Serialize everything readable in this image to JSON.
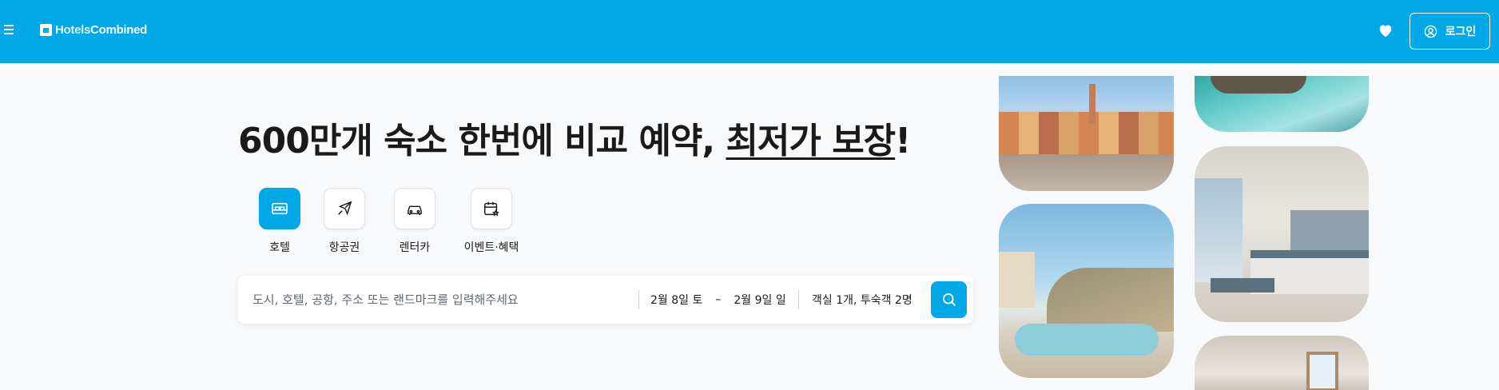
{
  "header": {
    "brand": {
      "part1": "Hotels",
      "part2": "Combined"
    },
    "login_label": "로그인",
    "bg_color": "#00a8e8"
  },
  "hero": {
    "headline_plain": "600만개 숙소 한번에 비교 예약, ",
    "headline_underlined": "최저가 보장",
    "headline_end": "!"
  },
  "tabs": [
    {
      "label": "호텔",
      "icon": "bed-icon",
      "active": true
    },
    {
      "label": "항공권",
      "icon": "plane-icon",
      "active": false
    },
    {
      "label": "렌터카",
      "icon": "car-icon",
      "active": false
    },
    {
      "label": "이벤트·혜택",
      "icon": "calendar-star-icon",
      "active": false
    }
  ],
  "search": {
    "placeholder": "도시, 호텔, 공항, 주소 또는 랜드마크를 입력해주세요",
    "checkin": "2월 8일 토",
    "separator": "–",
    "checkout": "2월 9일 일",
    "guests": "객실 1개, 투숙객 2명"
  }
}
